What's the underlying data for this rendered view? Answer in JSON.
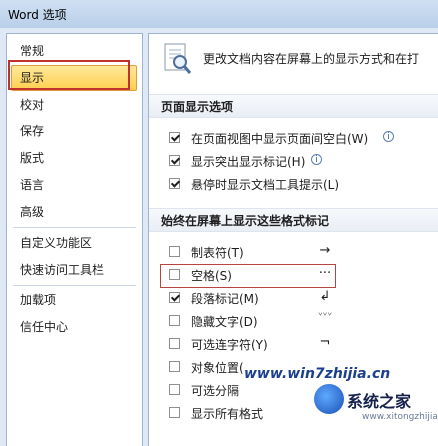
{
  "window": {
    "title": "Word 选项"
  },
  "sidebar": {
    "items": [
      {
        "label": "常规"
      },
      {
        "label": "显示",
        "selected": true
      },
      {
        "label": "校对"
      },
      {
        "label": "保存"
      },
      {
        "label": "版式"
      },
      {
        "label": "语言"
      },
      {
        "label": "高级"
      },
      {
        "label": "自定义功能区"
      },
      {
        "label": "快速访问工具栏"
      },
      {
        "label": "加载项"
      },
      {
        "label": "信任中心"
      }
    ]
  },
  "main": {
    "header": "更改文档内容在屏幕上的显示方式和在打",
    "page_section": {
      "title": "页面显示选项",
      "options": [
        {
          "label": "在页面视图中显示页面间空白(W)",
          "checked": true,
          "info": true
        },
        {
          "label": "显示突出显示标记(H)",
          "checked": true,
          "info": true
        },
        {
          "label": "悬停时显示文档工具提示(L)",
          "checked": true,
          "info": false
        }
      ]
    },
    "marks_section": {
      "title": "始终在屏幕上显示这些格式标记",
      "options": [
        {
          "label": "制表符(T)",
          "checked": false,
          "symbol": "→"
        },
        {
          "label": "空格(S)",
          "checked": false,
          "symbol": "···"
        },
        {
          "label": "段落标记(M)",
          "checked": true,
          "symbol": "↲"
        },
        {
          "label": "隐藏文字(D)",
          "checked": false,
          "symbol": "ᘁᘁᘁ"
        },
        {
          "label": "可选连字符(Y)",
          "checked": false,
          "symbol": "¬"
        },
        {
          "label": "对象位置(",
          "checked": false,
          "symbol": ""
        },
        {
          "label": "可选分隔",
          "checked": false,
          "symbol": ""
        },
        {
          "label": "显示所有格式",
          "checked": false,
          "symbol": ""
        }
      ]
    }
  },
  "watermark": {
    "url": "www.win7zhijia.cn",
    "name": "系统之家",
    "sub": "www.xitongzhijia.net"
  }
}
